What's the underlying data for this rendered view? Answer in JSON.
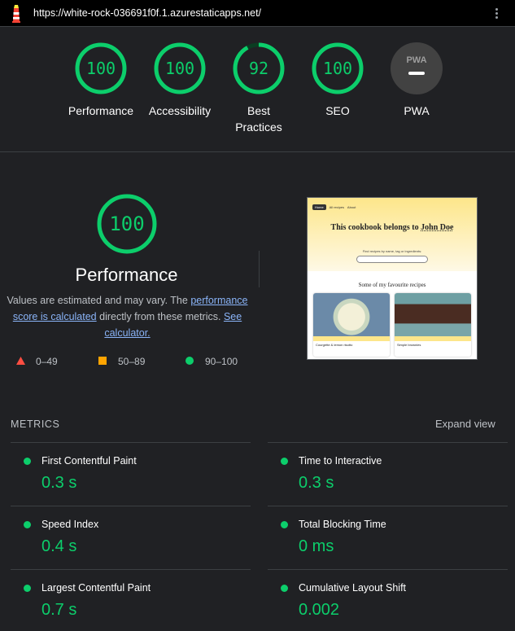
{
  "url_bar": {
    "url": "https://white-rock-036691f0f.1.azurestaticapps.net/"
  },
  "colors": {
    "pass": "#0cce6b",
    "average": "#ffa400",
    "fail": "#ff4e42",
    "background": "#202124",
    "pwa_gauge": "#424242"
  },
  "gauges": [
    {
      "score": "100",
      "score_fraction": 1.0,
      "label": "Performance"
    },
    {
      "score": "100",
      "score_fraction": 1.0,
      "label": "Accessibility"
    },
    {
      "score": "92",
      "score_fraction": 0.92,
      "label": "Best Practices"
    },
    {
      "score": "100",
      "score_fraction": 1.0,
      "label": "SEO"
    },
    {
      "badge": "PWA",
      "label": "PWA"
    }
  ],
  "performance": {
    "score": "100",
    "score_fraction": 1.0,
    "title": "Performance",
    "desc_prefix": "Values are estimated and may vary. The ",
    "link_score": "performance score is calculated",
    "desc_middle": " directly from these metrics. ",
    "link_calculator": "See calculator."
  },
  "legend": [
    {
      "icon": "triangle-icon",
      "range": "0–49"
    },
    {
      "icon": "square-icon",
      "range": "50–89"
    },
    {
      "icon": "circle-icon",
      "range": "90–100"
    }
  ],
  "screenshot": {
    "nav_items": [
      "Home",
      "All recipes",
      "About"
    ],
    "heading_prefix": "This cookbook belongs to ",
    "heading_name": "John Doe",
    "search_hint": "Find recipes by name, tag or ingredients:",
    "section_title": "Some of my favourite recipes",
    "cards": [
      {
        "title": "Courgette & lemon risotto"
      },
      {
        "title": "Simple brownies"
      }
    ]
  },
  "metrics": {
    "heading": "METRICS",
    "expand_label": "Expand view",
    "items": [
      {
        "label": "First Contentful Paint",
        "value": "0.3 s"
      },
      {
        "label": "Time to Interactive",
        "value": "0.3 s"
      },
      {
        "label": "Speed Index",
        "value": "0.4 s"
      },
      {
        "label": "Total Blocking Time",
        "value": "0 ms"
      },
      {
        "label": "Largest Contentful Paint",
        "value": "0.7 s"
      },
      {
        "label": "Cumulative Layout Shift",
        "value": "0.002"
      }
    ]
  }
}
